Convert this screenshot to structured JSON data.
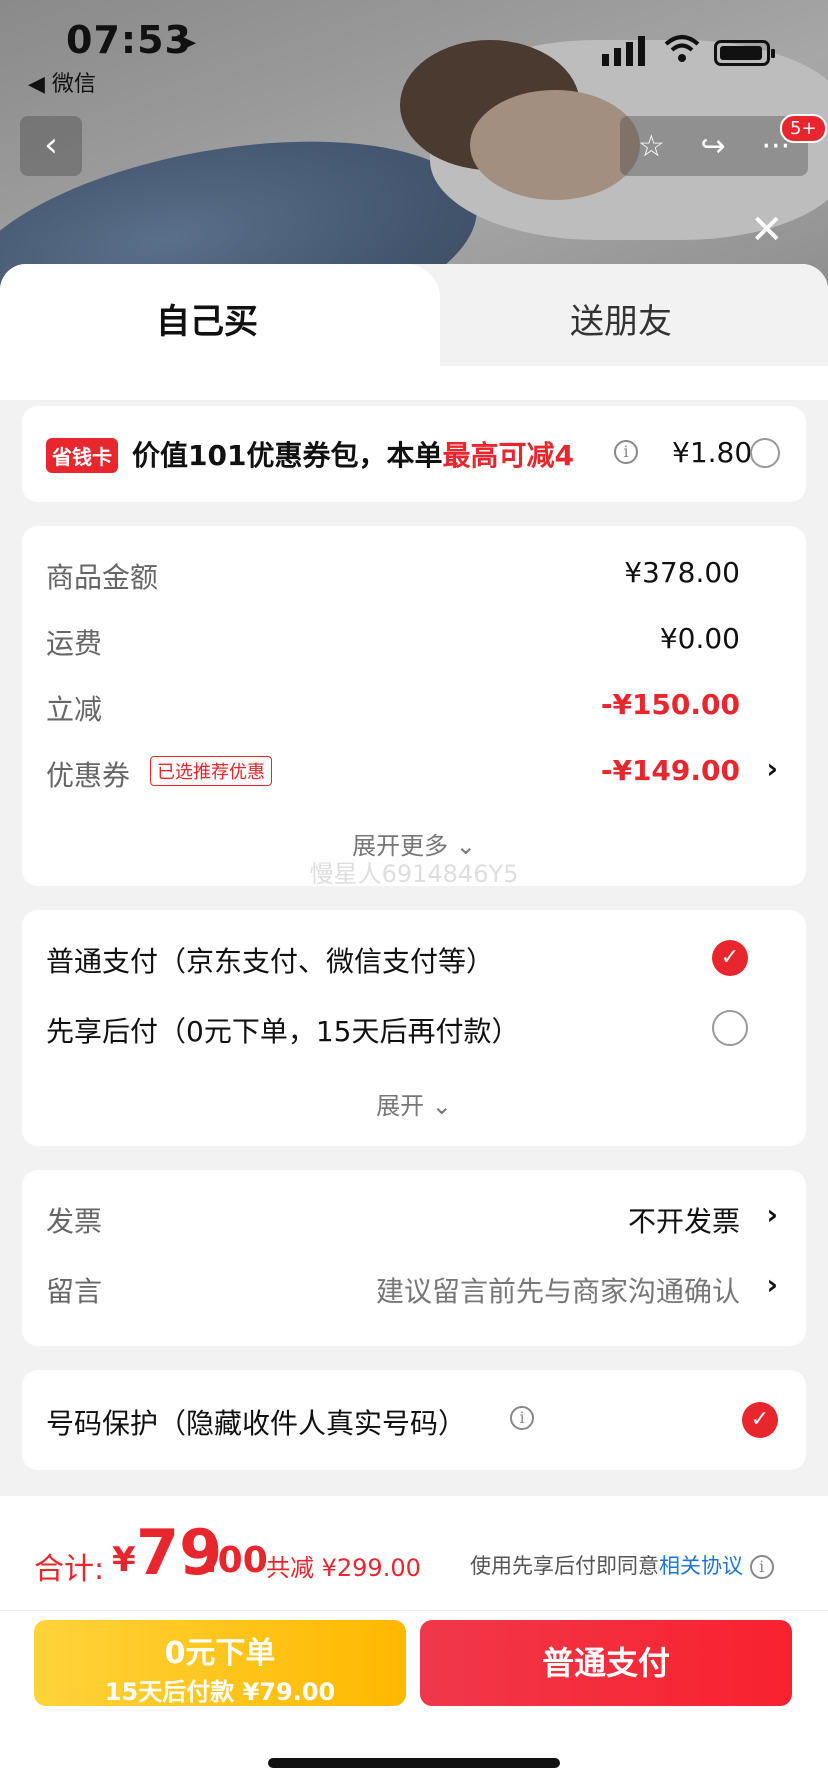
{
  "status_bar": {
    "time": "07:53",
    "back_app": "◀ 微信"
  },
  "product_header": {
    "badge": "5+"
  },
  "tabs": [
    {
      "label": "自己买",
      "active": true
    },
    {
      "label": "送朋友",
      "active": false
    }
  ],
  "coupon_pack": {
    "tag": "省钱卡",
    "text_prefix": "价值101优惠券包，本单",
    "text_highlight": "最高可减4",
    "price": "¥1.80",
    "selected": false
  },
  "price_breakdown": {
    "rows": [
      {
        "label": "商品金额",
        "value": "¥378.00"
      },
      {
        "label": "运费",
        "value": "¥0.00"
      },
      {
        "label": "立减",
        "value": "-¥150.00"
      },
      {
        "label": "优惠券",
        "value": "-¥149.00",
        "tag": "已选推荐优惠"
      }
    ],
    "expand_label": "展开更多",
    "watermark": "慢星人6914846Y5"
  },
  "payment_methods": {
    "options": [
      {
        "label": "普通支付（京东支付、微信支付等）",
        "selected": true
      },
      {
        "label": "先享后付（0元下单，15天后再付款）",
        "selected": false
      }
    ],
    "expand_label": "展开"
  },
  "invoice": {
    "label": "发票",
    "value": "不开发票"
  },
  "message": {
    "label": "留言",
    "placeholder": "建议留言前先与商家沟通确认"
  },
  "privacy": {
    "label": "号码保护（隐藏收件人真实号码）",
    "checked": true
  },
  "footer": {
    "total_label": "合计:",
    "currency": "¥",
    "total_int": "79",
    "total_dec": ".00",
    "total_saving": "共减 ¥299.00",
    "agree_text": "使用先享后付即同意",
    "agree_link": "相关协议",
    "btn_zero_line1": "0元下单",
    "btn_zero_line2": "15天后付款 ¥79.00",
    "btn_pay": "普通支付"
  },
  "colors": {
    "accent_red": "#e8262e",
    "link_blue": "#1e74d6",
    "btn_yellow": "#ffc11a"
  }
}
